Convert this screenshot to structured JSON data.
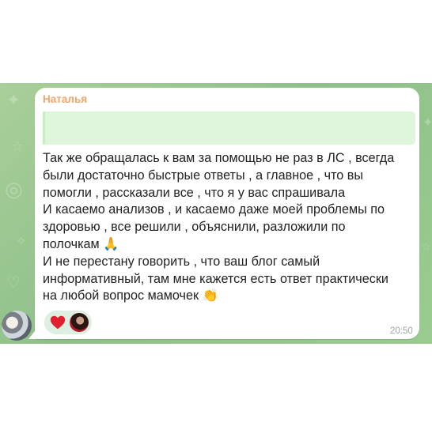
{
  "chat": {
    "sender_name": "Наталья",
    "message_text": "Так же обращалась к вам за помощью не раз в ЛС , всегда\nбыли достаточно быстрые ответы , а главное , что вы\nпомогли , рассказали все , что я у вас спрашивала\nИ касаемо анализов , и касаемо даже моей проблемы по\nздоровью , все решили , объяснили, разложили по\nполочкам 🙏\nИ не перестану говорить , что ваш блог самый\nинформативный, там мне кажется есть ответ практически\nна любой вопрос мамочек 👏",
    "reaction_icon": "heart-icon",
    "time": "20:50"
  },
  "colors": {
    "chat_background": "#9cc78f",
    "bubble": "#ffffff",
    "sender_name": "#f0a66c",
    "reply_block": "#dff5dc",
    "reaction_chip": "#dcefe0",
    "heart": "#e0202e",
    "time": "#9aa3a8"
  }
}
